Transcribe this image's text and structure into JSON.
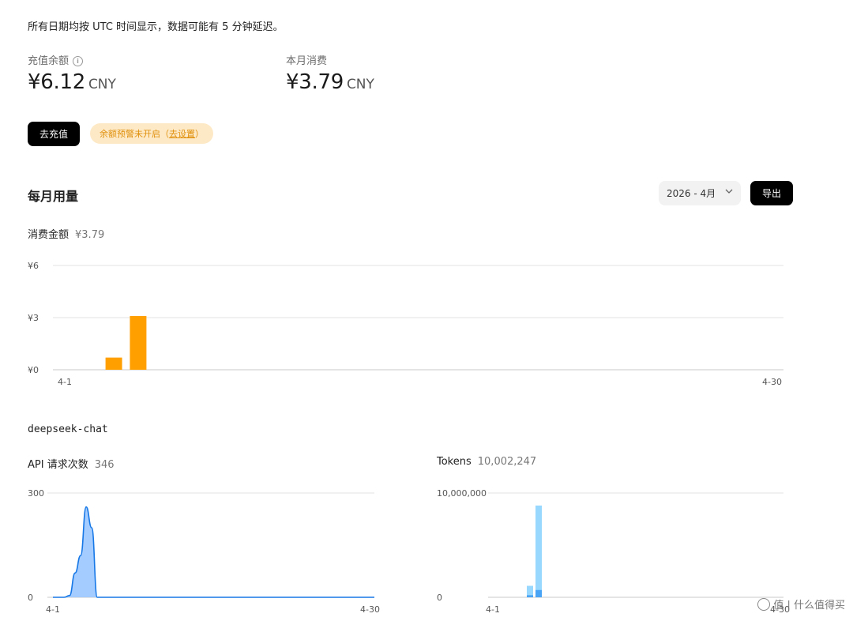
{
  "notice": "所有日期均按 UTC 时间显示，数据可能有 5 分钟延迟。",
  "balance": {
    "label": "充值余额",
    "amount": "¥6.12",
    "unit": "CNY"
  },
  "month_spend": {
    "label": "本月消费",
    "amount": "¥3.79",
    "unit": "CNY"
  },
  "recharge_button": "去充值",
  "warning": {
    "text": "余额预警未开启（",
    "link": "去设置",
    "close": "）"
  },
  "monthly": {
    "title": "每月用量",
    "month_select": "2026 - 4月",
    "export_button": "导出"
  },
  "spend_chart_label": {
    "label": "消费金额",
    "value": "¥3.79"
  },
  "model_name": "deepseek-chat",
  "api_chart_label": {
    "label": "API 请求次数",
    "value": "346"
  },
  "tokens_chart_label": {
    "label": "Tokens",
    "value": "10,002,247"
  },
  "watermark": "值 | 什么值得买",
  "colors": {
    "spend_bar": "#ff9f00",
    "api_area": "#9fc9ff",
    "api_line": "#1677e6",
    "token_light": "#98d8ff",
    "token_dark": "#4aa4f5"
  },
  "chart_data": [
    {
      "type": "bar",
      "title": "消费金额",
      "categories": [
        "4-1",
        "4-2",
        "4-3",
        "4-4",
        "4-5",
        "4-6",
        "4-7",
        "4-8",
        "4-9",
        "4-10",
        "4-11",
        "4-12",
        "4-13",
        "4-14",
        "4-15",
        "4-16",
        "4-17",
        "4-18",
        "4-19",
        "4-20",
        "4-21",
        "4-22",
        "4-23",
        "4-24",
        "4-25",
        "4-26",
        "4-27",
        "4-28",
        "4-29",
        "4-30"
      ],
      "values": [
        0,
        0,
        0.7,
        3.09,
        0,
        0,
        0,
        0,
        0,
        0,
        0,
        0,
        0,
        0,
        0,
        0,
        0,
        0,
        0,
        0,
        0,
        0,
        0,
        0,
        0,
        0,
        0,
        0,
        0,
        0
      ],
      "yticks": [
        "¥0",
        "¥3",
        "¥6"
      ],
      "xticks": [
        "4-1",
        "4-30"
      ],
      "ylim": [
        0,
        6
      ]
    },
    {
      "type": "area",
      "title": "API 请求次数",
      "categories": [
        "4-1",
        "4-30"
      ],
      "x": [
        0,
        1,
        1.5,
        2,
        2.5,
        3,
        3.5,
        4,
        5,
        29
      ],
      "values": [
        0,
        0,
        5,
        70,
        120,
        260,
        200,
        0,
        0,
        0
      ],
      "yticks": [
        "0",
        "300"
      ],
      "xticks": [
        "4-1",
        "4-30"
      ],
      "ylim": [
        0,
        300
      ]
    },
    {
      "type": "bar",
      "title": "Tokens",
      "categories": [
        "4-1",
        "4-2",
        "4-3",
        "4-4",
        "4-5",
        "4-6",
        "4-7",
        "4-8",
        "4-9",
        "4-10",
        "4-11",
        "4-12",
        "4-13",
        "4-14",
        "4-15",
        "4-16",
        "4-17",
        "4-18",
        "4-19",
        "4-20",
        "4-21",
        "4-22",
        "4-23",
        "4-24",
        "4-25",
        "4-26",
        "4-27",
        "4-28",
        "4-29",
        "4-30"
      ],
      "series": [
        {
          "values": [
            0,
            0,
            1100000,
            8800000,
            0,
            0,
            0,
            0,
            0,
            0,
            0,
            0,
            0,
            0,
            0,
            0,
            0,
            0,
            0,
            0,
            0,
            0,
            0,
            0,
            0,
            0,
            0,
            0,
            0,
            0
          ]
        },
        {
          "values": [
            0,
            0,
            200000,
            700000,
            0,
            0,
            0,
            0,
            0,
            0,
            0,
            0,
            0,
            0,
            0,
            0,
            0,
            0,
            0,
            0,
            0,
            0,
            0,
            0,
            0,
            0,
            0,
            0,
            0,
            0
          ]
        }
      ],
      "yticks": [
        "0",
        "10,000,000"
      ],
      "xticks": [
        "4-1",
        "4-30"
      ],
      "ylim": [
        0,
        10000000
      ]
    }
  ]
}
